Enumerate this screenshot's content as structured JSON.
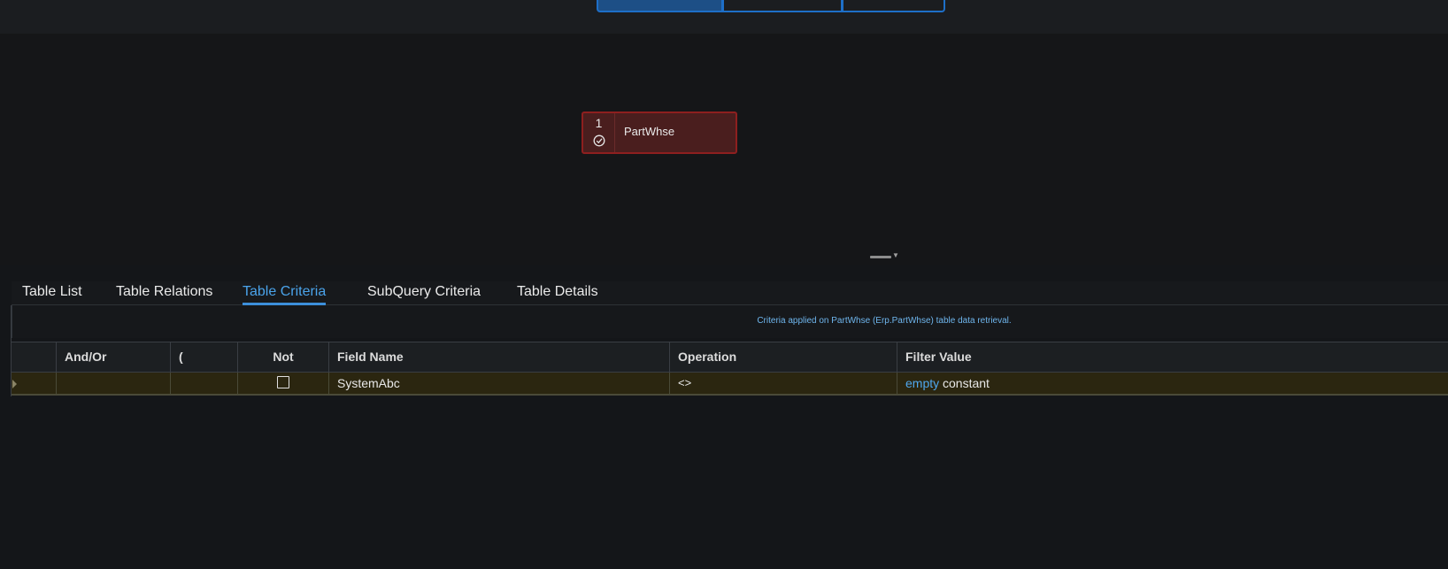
{
  "top_segments": [
    {
      "label": "",
      "active": true
    },
    {
      "label": "",
      "active": false
    },
    {
      "label": "",
      "active": false
    }
  ],
  "diagram": {
    "node": {
      "number": "1",
      "label": "PartWhse",
      "icon": "check-circle-icon"
    }
  },
  "tabs": [
    {
      "label": "Table List",
      "active": false
    },
    {
      "label": "Table Relations",
      "active": false
    },
    {
      "label": "Table Criteria",
      "active": true
    },
    {
      "label": "SubQuery Criteria",
      "active": false
    },
    {
      "label": "Table Details",
      "active": false
    }
  ],
  "criteria_caption": "Criteria applied on PartWhse (Erp.PartWhse) table data retrieval.",
  "grid": {
    "columns": [
      "",
      "And/Or",
      "(",
      "Not",
      "Field Name",
      "Operation",
      "Filter Value"
    ],
    "rows": [
      {
        "and_or": "",
        "paren": "",
        "not_checked": false,
        "field_name": "SystemAbc",
        "operation": "<>",
        "filter_value_kind": "empty",
        "filter_value_type": "constant"
      }
    ]
  },
  "colors": {
    "accent": "#3d8fdb",
    "node_bg": "#4a1e1e",
    "node_border": "#8e1f1f",
    "row_highlight": "#2b2610"
  }
}
